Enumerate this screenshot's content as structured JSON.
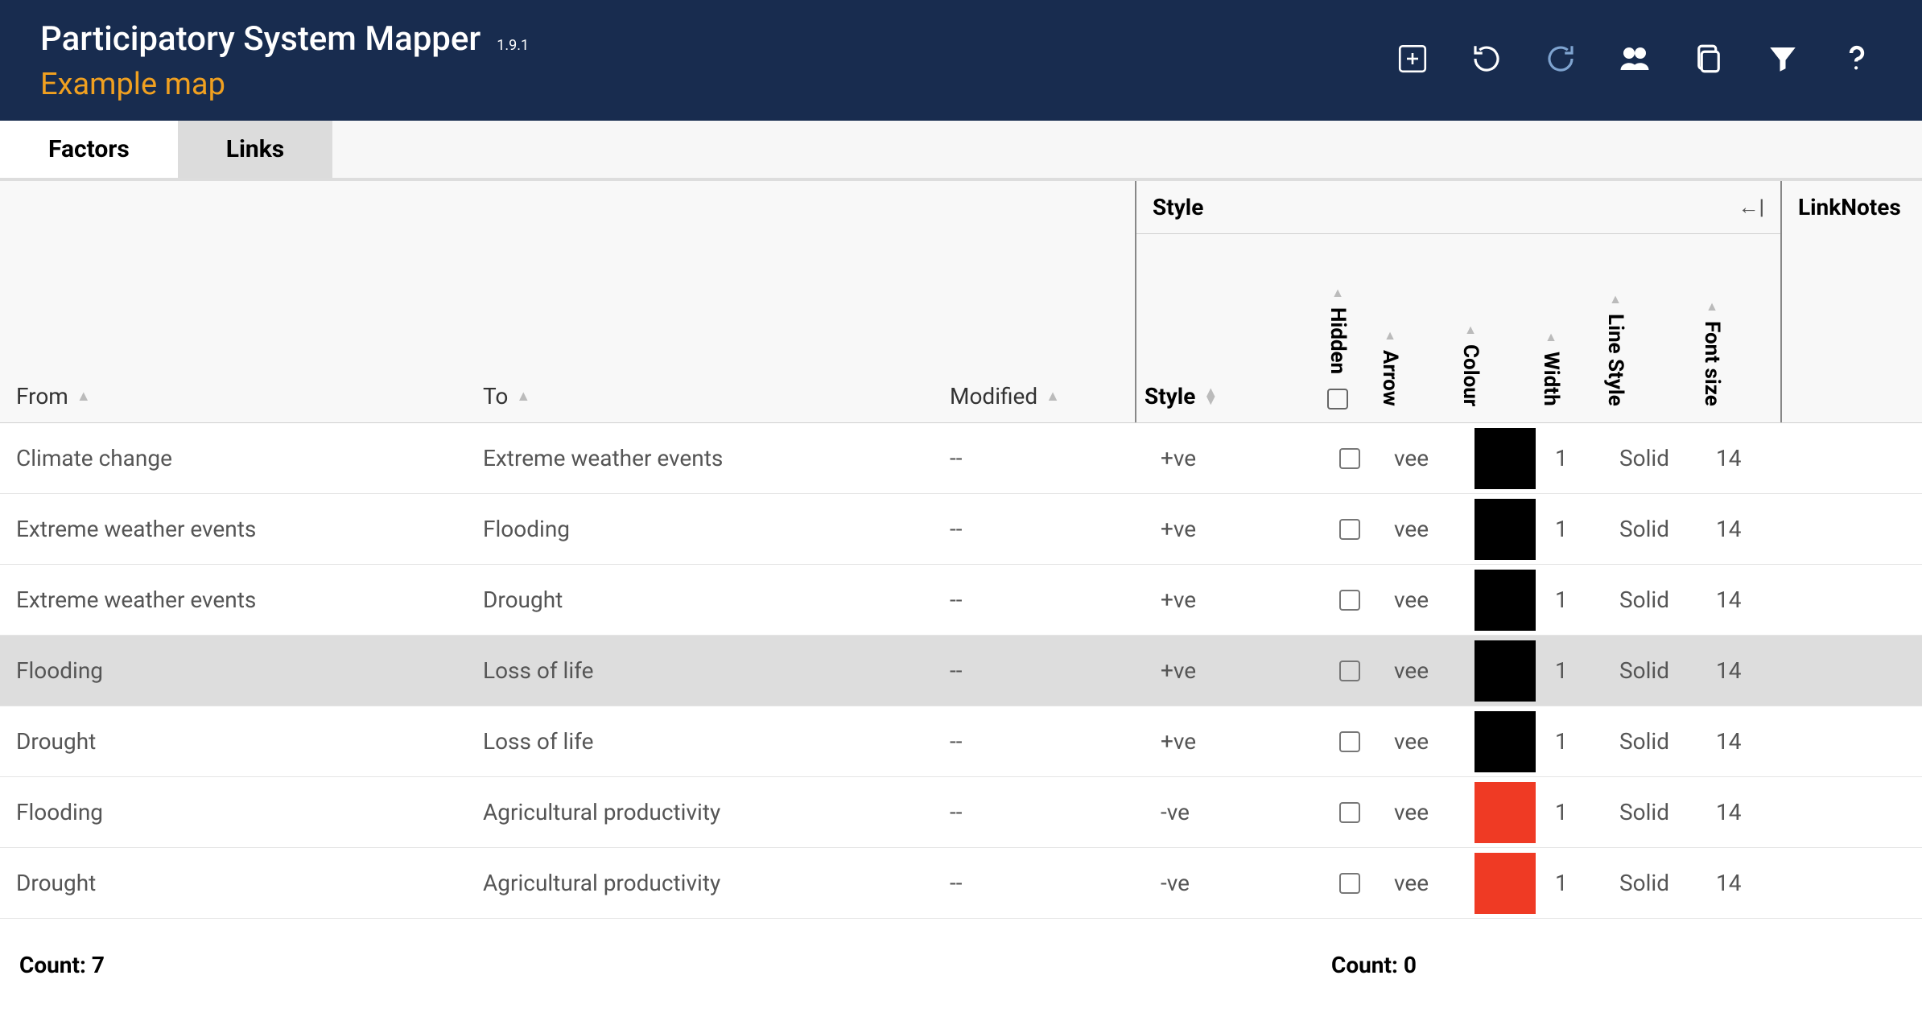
{
  "app": {
    "title": "Participatory System Mapper",
    "version": "1.9.1",
    "subtitle": "Example map"
  },
  "tabs": {
    "factors": "Factors",
    "links": "Links",
    "active": "links"
  },
  "groupHeaders": {
    "style": "Style",
    "linkNotes": "LinkNotes"
  },
  "columns": {
    "from": "From",
    "to": "To",
    "modified": "Modified",
    "style": "Style",
    "hidden": "Hidden",
    "arrow": "Arrow",
    "colour": "Colour",
    "width": "Width",
    "lineStyle": "Line Style",
    "fontSize": "Font size"
  },
  "rows": [
    {
      "from": "Climate change",
      "to": "Extreme weather events",
      "modified": "--",
      "style": "+ve",
      "hidden": false,
      "arrow": "vee",
      "colour": "#000000",
      "width": "1",
      "lineStyle": "Solid",
      "fontSize": "14",
      "selected": false
    },
    {
      "from": "Extreme weather events",
      "to": "Flooding",
      "modified": "--",
      "style": "+ve",
      "hidden": false,
      "arrow": "vee",
      "colour": "#000000",
      "width": "1",
      "lineStyle": "Solid",
      "fontSize": "14",
      "selected": false
    },
    {
      "from": "Extreme weather events",
      "to": "Drought",
      "modified": "--",
      "style": "+ve",
      "hidden": false,
      "arrow": "vee",
      "colour": "#000000",
      "width": "1",
      "lineStyle": "Solid",
      "fontSize": "14",
      "selected": false
    },
    {
      "from": "Flooding",
      "to": "Loss of life",
      "modified": "--",
      "style": "+ve",
      "hidden": false,
      "arrow": "vee",
      "colour": "#000000",
      "width": "1",
      "lineStyle": "Solid",
      "fontSize": "14",
      "selected": true
    },
    {
      "from": "Drought",
      "to": "Loss of life",
      "modified": "--",
      "style": "+ve",
      "hidden": false,
      "arrow": "vee",
      "colour": "#000000",
      "width": "1",
      "lineStyle": "Solid",
      "fontSize": "14",
      "selected": false
    },
    {
      "from": "Flooding",
      "to": "Agricultural productivity",
      "modified": "--",
      "style": "-ve",
      "hidden": false,
      "arrow": "vee",
      "colour": "#ef3a24",
      "width": "1",
      "lineStyle": "Solid",
      "fontSize": "14",
      "selected": false
    },
    {
      "from": "Drought",
      "to": "Agricultural productivity",
      "modified": "--",
      "style": "-ve",
      "hidden": false,
      "arrow": "vee",
      "colour": "#ef3a24",
      "width": "1",
      "lineStyle": "Solid",
      "fontSize": "14",
      "selected": false
    }
  ],
  "footer": {
    "countLeftLabel": "Count:",
    "countLeft": "7",
    "countRightLabel": "Count:",
    "countRight": "0"
  }
}
